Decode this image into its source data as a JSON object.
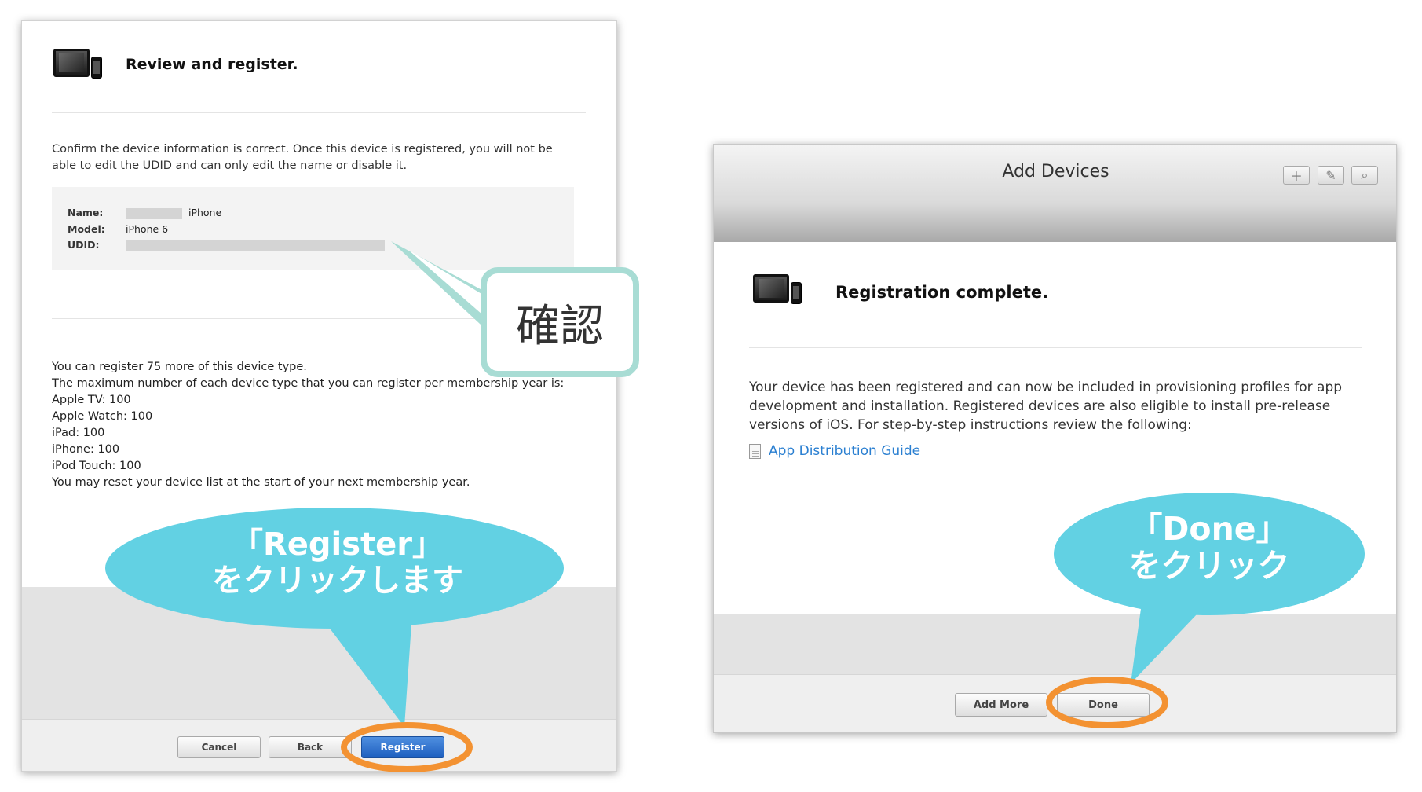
{
  "left_panel": {
    "title": "Review and register.",
    "confirm_text": "Confirm the device information is correct. Once this device is registered, you will not be able to edit the UDID and can only edit the name or disable it.",
    "device": {
      "name_label": "Name:",
      "name_value": "iPhone",
      "model_label": "Model:",
      "model_value": "iPhone 6",
      "udid_label": "UDID:"
    },
    "limits": [
      "You can register 75 more of this device type.",
      "The maximum number of each device type that you can register per membership year is:",
      "Apple TV: 100",
      "Apple Watch: 100",
      "iPad: 100",
      "iPhone: 100",
      "iPod Touch: 100",
      "You may reset your device list at the start of your next membership year."
    ],
    "buttons": {
      "cancel": "Cancel",
      "back": "Back",
      "register": "Register"
    }
  },
  "right_panel": {
    "window_title": "Add Devices",
    "toolbar_icons": [
      "plus-icon",
      "edit-icon",
      "search-icon"
    ],
    "title": "Registration complete.",
    "body_text": "Your device has been registered and can now be included in provisioning profiles for app development and installation. Registered devices are also eligible to install pre-release versions of iOS. For step-by-step instructions review the following:",
    "link_text": "App Distribution Guide",
    "buttons": {
      "add_more": "Add More",
      "done": "Done"
    }
  },
  "annotations": {
    "confirm_label": "確認",
    "register_bubble_line1": "「Register」",
    "register_bubble_line2": "をクリックします",
    "done_bubble_line1": "「Done」",
    "done_bubble_line2": "をクリック"
  },
  "colors": {
    "bubble": "#62d1e3",
    "callout_border": "#a8dcd4",
    "highlight_ring": "#f39232",
    "link": "#2a7fd1",
    "primary_button": "#1e5fbf"
  }
}
